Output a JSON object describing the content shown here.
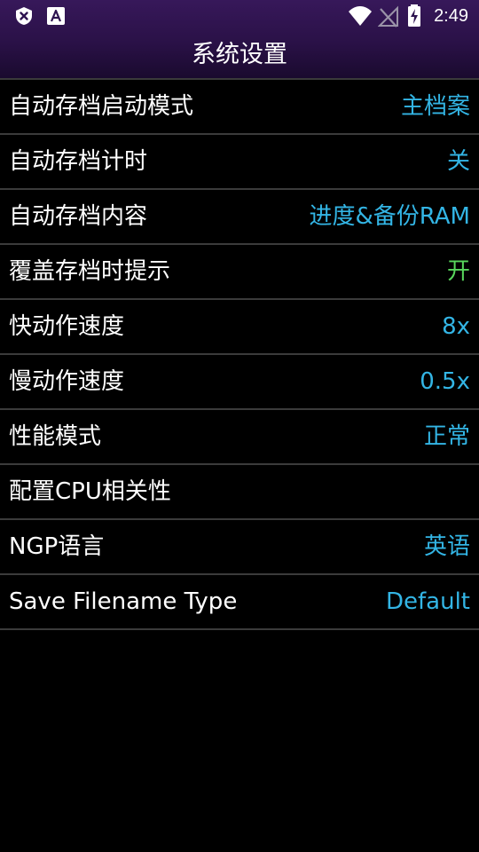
{
  "status_bar": {
    "time": "2:49",
    "left_icons": [
      "shield-x-icon",
      "font-a-icon"
    ],
    "right_icons": [
      "wifi-icon",
      "no-signal-icon",
      "battery-charging-icon"
    ]
  },
  "header": {
    "title": "系统设置"
  },
  "settings": [
    {
      "label": "自动存档启动模式",
      "value": "主档案"
    },
    {
      "label": "自动存档计时",
      "value": "关"
    },
    {
      "label": "自动存档内容",
      "value": "进度&备份RAM"
    },
    {
      "label": "覆盖存档时提示",
      "value": "开"
    },
    {
      "label": "快动作速度",
      "value": "8x"
    },
    {
      "label": "慢动作速度",
      "value": "0.5x"
    },
    {
      "label": "性能模式",
      "value": "正常"
    },
    {
      "label": "配置CPU相关性",
      "value": ""
    },
    {
      "label": "NGP语言",
      "value": "英语"
    },
    {
      "label": "Save Filename Type",
      "value": "Default"
    }
  ],
  "colors": {
    "header_top": "#37185a",
    "header_bottom": "#1a0a2e",
    "value_accent": "#33b5e5",
    "value_on": "#58d65c",
    "divider": "#3b3b3b"
  }
}
